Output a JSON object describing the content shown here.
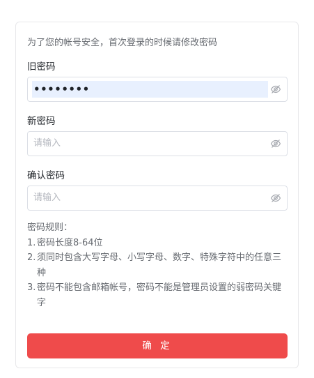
{
  "notice": "为了您的帐号安全，首次登录的时候请修改密码",
  "fields": {
    "old_password": {
      "label": "旧密码",
      "value": "••••••••",
      "icon": "eye-off-icon"
    },
    "new_password": {
      "label": "新密码",
      "placeholder": "请输入",
      "icon": "eye-off-icon"
    },
    "confirm_password": {
      "label": "确认密码",
      "placeholder": "请输入",
      "icon": "eye-off-icon"
    }
  },
  "rules": {
    "title": "密码规则：",
    "items": [
      {
        "num": "1.",
        "text": "密码长度8-64位"
      },
      {
        "num": "2.",
        "text": "须同时包含大写字母、小写字母、数字、特殊字符中的任意三种"
      },
      {
        "num": "3.",
        "text": "密码不能包含邮箱帐号，密码不能是管理员设置的弱密码关键字"
      }
    ]
  },
  "submit_label": "确 定",
  "colors": {
    "accent": "#ef4b4b",
    "autofill": "#e8f0fe"
  }
}
